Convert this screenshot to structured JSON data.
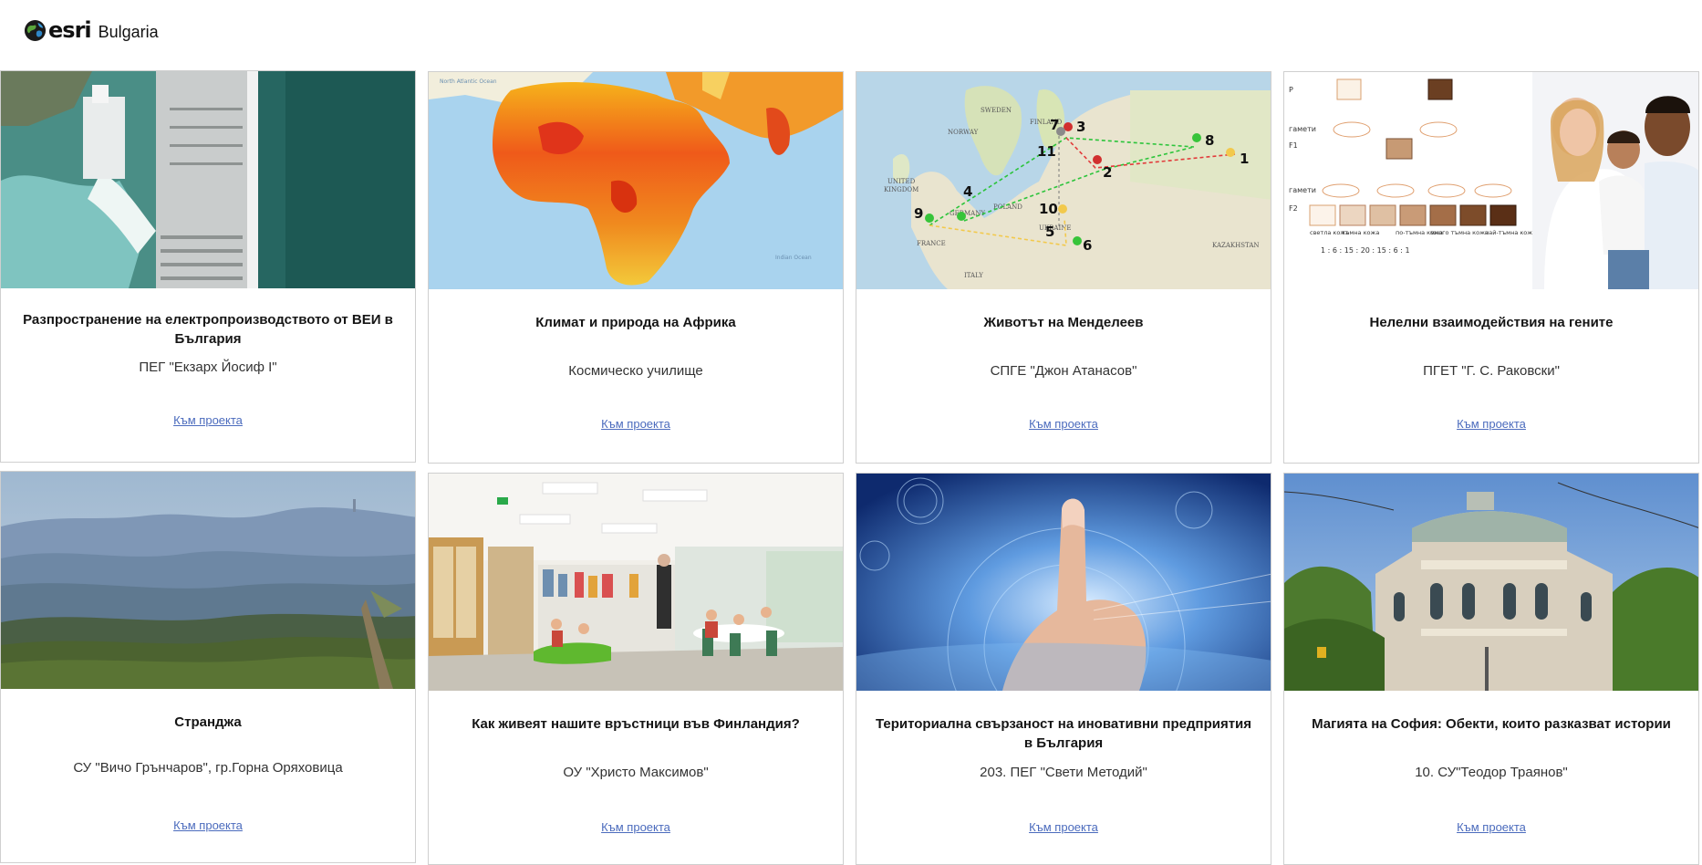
{
  "header": {
    "logo_text": "esri",
    "logo_subtitle": "Bulgaria"
  },
  "cards": [
    {
      "title": "Разпространение на електропроизводството от ВЕИ в България",
      "school": "ПЕГ \"Екзарх Йосиф I\"",
      "link": "Към проекта",
      "image": "hydro-dam-photo"
    },
    {
      "title": "Климат и природа на Африка",
      "school": "Космическо училище",
      "link": "Към проекта",
      "image": "africa-climate-map"
    },
    {
      "title": "Животът на Менделеев",
      "school": "СПГЕ \"Джон Атанасов\"",
      "link": "Към проекта",
      "image": "europe-route-map"
    },
    {
      "title": "Нелелни взаимодействия на гените",
      "school": "ПГЕТ \"Г. С. Раковски\"",
      "link": "Към проекта",
      "image": "genetics-diagram-family"
    },
    {
      "title": "Странджа",
      "school": "СУ \"Вичо Грънчаров\", гр.Горна Оряховица",
      "link": "Към проекта",
      "image": "strandzha-landscape"
    },
    {
      "title": "Как живеят нашите връстници във Финландия?",
      "school": "ОУ \"Христо Максимов\"",
      "link": "Към проекта",
      "image": "finnish-classroom-photo"
    },
    {
      "title": "Териториална свързаност на иновативни предприятия в България",
      "school": "203. ПЕГ \"Свети Методий\"",
      "link": "Към проекта",
      "image": "touchscreen-hand"
    },
    {
      "title": "Магията на София: Обекти, които разказват истории",
      "school": "10. СУ\"Теодор Траянов\"",
      "link": "Към проекта",
      "image": "sofia-university-building"
    }
  ],
  "thumb_labels": {
    "atlantic": "North Atlantic Ocean",
    "indian": "Indian Ocean",
    "europe_places": [
      "SWEDEN",
      "FINLAND",
      "NORWAY",
      "UNITED KINGDOM",
      "POLAND",
      "GERMANY",
      "FRANCE",
      "UKRAINE",
      "ITALY",
      "KAZAKHSTAN"
    ],
    "route_numbers": [
      "1",
      "2",
      "3",
      "4",
      "5",
      "6",
      "7",
      "8",
      "9",
      "10",
      "11"
    ],
    "genetics": {
      "p": "P",
      "gametes": "гамети",
      "f1": "F1",
      "f2": "F2",
      "labels": [
        "светла кожа",
        "тъмна кожа",
        "по-тъмна кожа",
        "много тъмна кожа",
        "най-тъмна кожа"
      ],
      "ratio": "1 : 6 : 15 : 20 : 15 : 6 : 1"
    }
  }
}
